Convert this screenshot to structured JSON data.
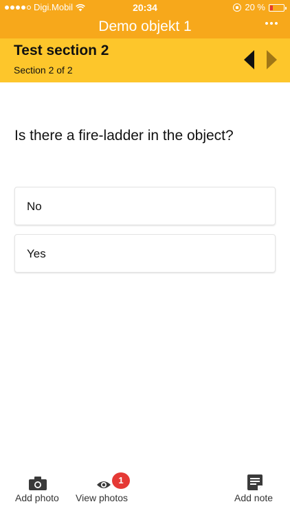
{
  "status_bar": {
    "carrier": "Digi.Mobil",
    "time": "20:34",
    "battery_text": "20 %"
  },
  "header": {
    "title": "Demo objekt 1",
    "menu_icon": "more-dots-icon"
  },
  "section": {
    "title": "Test section 2",
    "subtitle": "Section 2 of 2"
  },
  "question": {
    "text": "Is there a fire-ladder in the object?",
    "options": [
      {
        "label": "No"
      },
      {
        "label": "Yes"
      }
    ]
  },
  "toolbar": {
    "add_photo": "Add photo",
    "view_photos": "View photos",
    "view_photos_badge": "1",
    "add_note": "Add note"
  },
  "colors": {
    "title_bar": "#f7a81b",
    "section_bar": "#fdc62b",
    "badge": "#e53935"
  }
}
